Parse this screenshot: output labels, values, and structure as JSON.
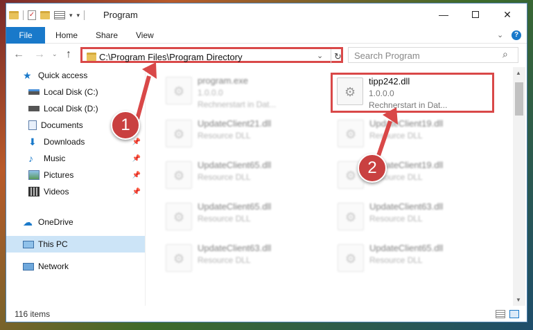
{
  "window": {
    "title": "Program"
  },
  "ribbon": {
    "file": "File",
    "tabs": [
      "Home",
      "Share",
      "View"
    ]
  },
  "address": {
    "path": "C:\\Program Files\\Program Directory"
  },
  "search": {
    "placeholder": "Search Program"
  },
  "sidebar": {
    "items": [
      {
        "label": "Quick access",
        "icon": "star-icon"
      },
      {
        "label": "Local Disk (C:)",
        "icon": "drive-icon"
      },
      {
        "label": "Local Disk (D:)",
        "icon": "drive-icon"
      },
      {
        "label": "Documents",
        "icon": "documents-icon"
      },
      {
        "label": "Downloads",
        "icon": "download-icon"
      },
      {
        "label": "Music",
        "icon": "music-icon"
      },
      {
        "label": "Pictures",
        "icon": "pictures-icon"
      },
      {
        "label": "Videos",
        "icon": "videos-icon"
      },
      {
        "label": "OneDrive",
        "icon": "cloud-icon"
      },
      {
        "label": "This PC",
        "icon": "computer-icon"
      },
      {
        "label": "Network",
        "icon": "network-icon"
      }
    ]
  },
  "files": [
    {
      "name": "program.exe",
      "line2": "1.0.0.0",
      "line3": "Rechnerstart in Dat..."
    },
    {
      "name": "tipp242.dll",
      "line2": "1.0.0.0",
      "line3": "Rechnerstart in Dat..."
    },
    {
      "name": "UpdateClient21.dll",
      "line2": "Resource DLL"
    },
    {
      "name": "UpdateClient19.dll",
      "line2": "Resource DLL"
    },
    {
      "name": "UpdateClient65.dll",
      "line2": "Resource DLL"
    },
    {
      "name": "UpdateClient19.dll",
      "line2": "Resource DLL"
    },
    {
      "name": "UpdateClient65.dll",
      "line2": "Resource DLL"
    },
    {
      "name": "UpdateClient63.dll",
      "line2": "Resource DLL"
    },
    {
      "name": "UpdateClient63.dll",
      "line2": "Resource DLL"
    },
    {
      "name": "UpdateClient65.dll",
      "line2": "Resource DLL"
    }
  ],
  "status": {
    "count": "116 items"
  },
  "callouts": [
    "1",
    "2"
  ],
  "colors": {
    "accent": "#1979ca",
    "highlight": "#d94848",
    "callout": "#c94040"
  }
}
